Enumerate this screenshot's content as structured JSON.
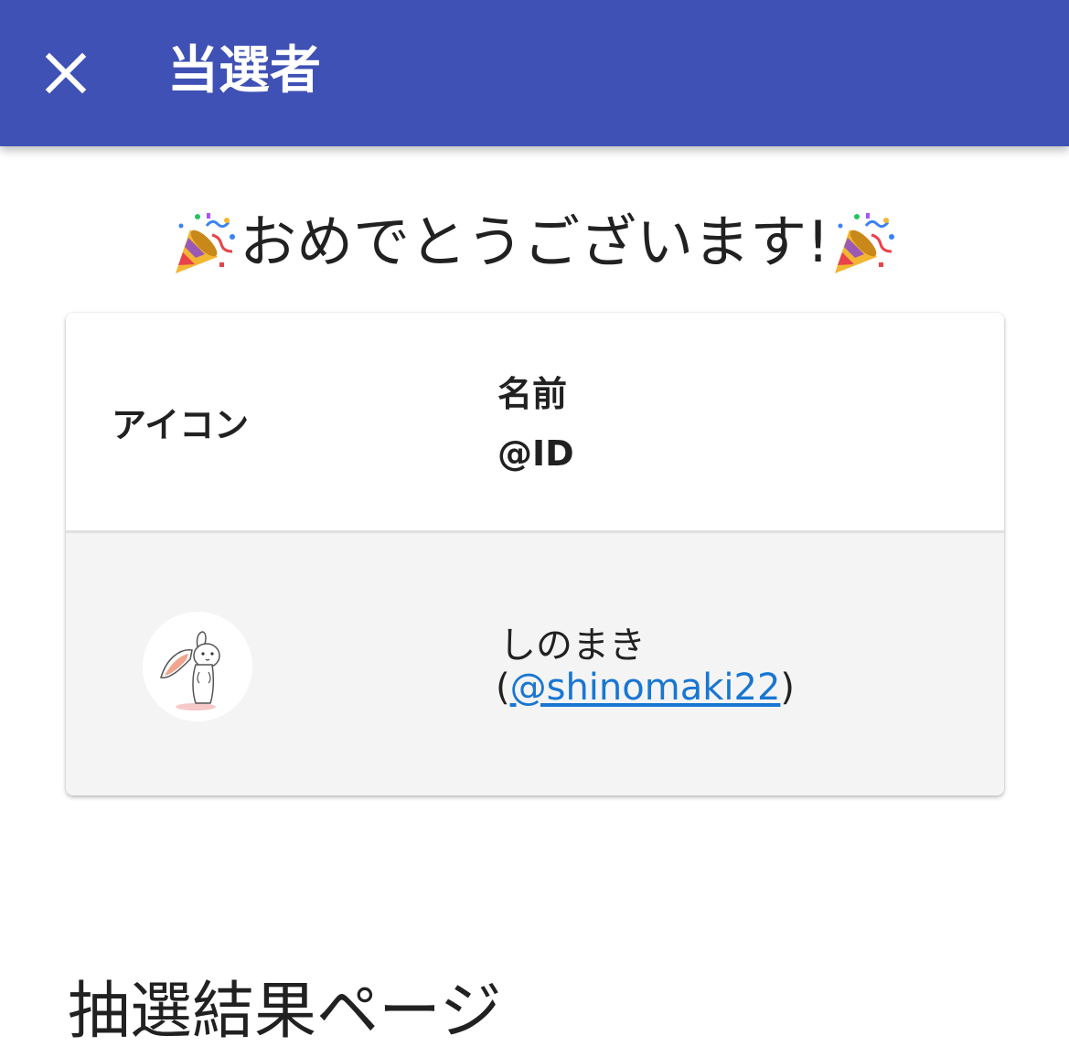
{
  "app_bar": {
    "title": "当選者",
    "close_icon": "close-icon",
    "color": "#3f51b5"
  },
  "congrats": {
    "text": "おめでとうございます!",
    "icon": "party-popper-icon"
  },
  "table": {
    "header": {
      "icon_label": "アイコン",
      "name_label": "名前",
      "id_label": "@ID"
    },
    "rows": [
      {
        "avatar": "rabbit-avatar",
        "name": "しのまき",
        "id_prefix": "(",
        "id": "@shinomaki22",
        "id_suffix": ")"
      }
    ]
  },
  "results_heading": "抽選結果ページ",
  "colors": {
    "link": "#1976d2",
    "row_background": "#f4f4f4"
  }
}
